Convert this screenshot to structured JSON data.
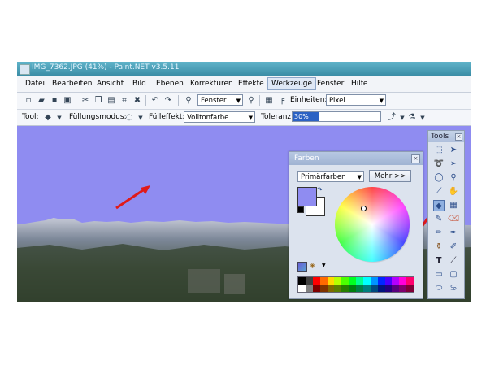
{
  "window": {
    "title": "IMG_7362.JPG (41%) - Paint.NET v3.5.11"
  },
  "menu": [
    "Datei",
    "Bearbeiten",
    "Ansicht",
    "Bild",
    "Ebenen",
    "Korrekturen",
    "Effekte",
    "Werkzeuge",
    "Fenster",
    "Hilfe"
  ],
  "toolbar1": {
    "zoom_value": "Fenster",
    "units_label": "Einheiten:",
    "units_value": "Pixel"
  },
  "toolbar2": {
    "tool_label": "Tool:",
    "fill_mode_label": "Füllungsmodus:",
    "fill_effect_label": "Fülleffekt:",
    "fill_effect_value": "Volltonfarbe",
    "tolerance_label": "Toleranz:",
    "tolerance_value": "30%",
    "tolerance_fraction": 0.3
  },
  "farben": {
    "title": "Farben",
    "mode_value": "Primärfarben",
    "more_button": "Mehr >>"
  },
  "tools_panel": {
    "title": "Tools"
  },
  "colors": {
    "primary": "#8f8cf1",
    "secondary": "#ffffff",
    "titlebar": "#3b8da6",
    "arrow": "#e01a1a"
  },
  "tool_icons": [
    "rect-select-icon",
    "move-selection-icon",
    "lasso-icon",
    "move-pixels-icon",
    "ellipse-select-icon",
    "zoom-icon",
    "magic-wand-icon",
    "pan-icon",
    "paint-bucket-icon",
    "gradient-icon",
    "paintbrush-icon",
    "eraser-icon",
    "pencil-icon",
    "color-picker-icon",
    "clone-stamp-icon",
    "recolor-icon",
    "text-icon",
    "line-icon",
    "rectangle-icon",
    "rounded-rect-icon",
    "ellipse-icon",
    "freeform-icon"
  ]
}
